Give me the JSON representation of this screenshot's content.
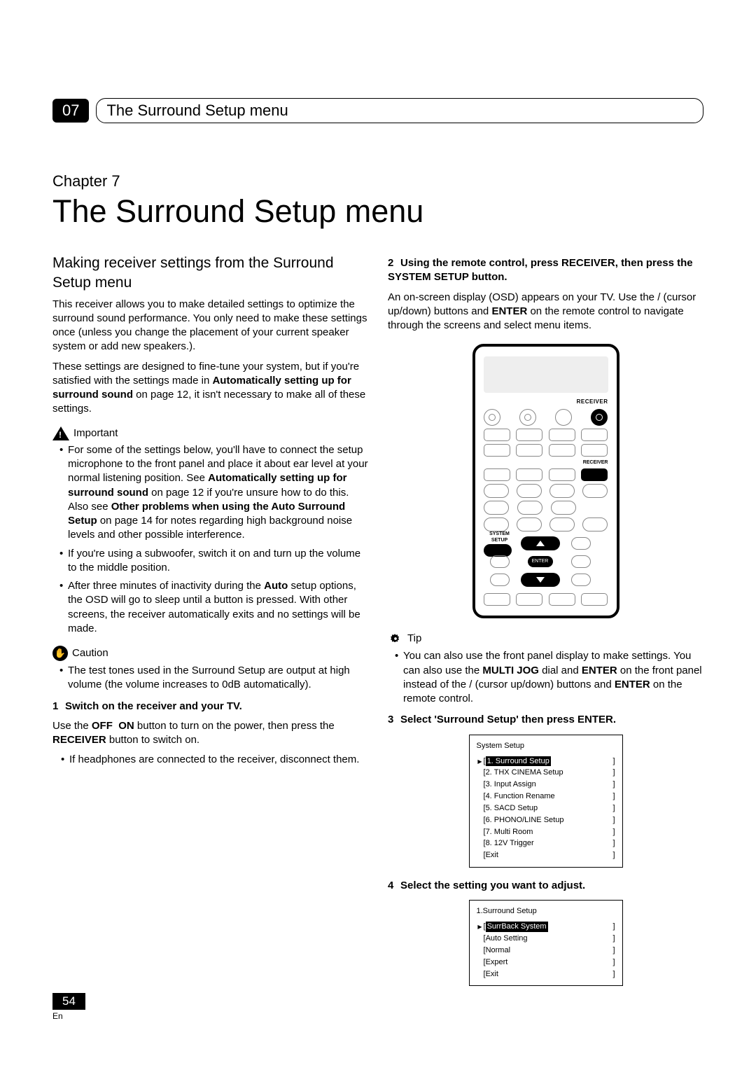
{
  "header": {
    "section_number": "07",
    "section_title": "The Surround Setup menu"
  },
  "chapter": {
    "label": "Chapter 7",
    "title": "The Surround Setup menu"
  },
  "left": {
    "subheading": "Making receiver settings from the Surround Setup menu",
    "intro1": "This receiver allows you to make detailed settings to optimize the surround sound performance. You only need to make these settings once (unless you change the placement of your current speaker system or add new speakers.).",
    "intro2_a": "These settings are designed to fine-tune your system, but if you're satisfied with the settings made in ",
    "intro2_b": "Automatically setting up for surround sound",
    "intro2_c": " on page 12, it isn't necessary to make all of these settings.",
    "important_label": "Important",
    "imp_b1_a": "For some of the settings below, you'll have to connect the setup microphone to the front panel and place it about ear level at your normal listening position. See ",
    "imp_b1_b": "Automatically setting up for surround sound",
    "imp_b1_c": " on page 12 if you're unsure how to do this. Also see ",
    "imp_b1_d": "Other problems when using the Auto Surround Setup",
    "imp_b1_e": " on page 14 for notes regarding high background noise levels and other possible interference.",
    "imp_b2": "If you're using a subwoofer, switch it on and turn up the volume to the middle position.",
    "imp_b3_a": "After three minutes of inactivity during the ",
    "imp_b3_b": "Auto",
    "imp_b3_c": " setup options, the OSD will go to sleep until a button is pressed. With other screens, the receiver automatically exits and no settings will be made.",
    "caution_label": "Caution",
    "caution_b1": "The test tones used in the Surround Setup are output at high volume (the volume increases to 0dB automatically).",
    "step1_num": "1",
    "step1_title": "Switch on the receiver and your TV.",
    "step1_body_a": "Use the  ",
    "step1_body_off": "OFF",
    "step1_body_on": "ON",
    "step1_body_b": " button to turn on the power, then press the   ",
    "step1_body_recv": "RECEIVER",
    "step1_body_c": " button to switch on.",
    "step1_sub": "If headphones are connected to the receiver, disconnect them."
  },
  "right": {
    "step2_num": "2",
    "step2_title": "Using the remote control, press RECEIVER, then press the SYSTEM SETUP button.",
    "step2_body_a": "An on-screen display (OSD) appears on your TV. Use the   /   (cursor up/down) buttons and ",
    "step2_body_enter": "ENTER",
    "step2_body_b": " on the remote control to navigate through the screens and select menu items.",
    "remote": {
      "label_receiver": "RECEIVER",
      "label_sys": "SYSTEM SETUP",
      "label_enter": "ENTER",
      "label_recv_btn": "RECEIVER"
    },
    "tip_label": "Tip",
    "tip_a": "You can also use the front panel display to make settings. You can also use the ",
    "tip_b": "MULTI JOG",
    "tip_c": " dial and ",
    "tip_d": "ENTER",
    "tip_e": " on the front panel instead of the   /   (cursor up/down) buttons and ",
    "tip_f": "ENTER",
    "tip_g": " on the remote control.",
    "step3_num": "3",
    "step3_title": "Select 'Surround Setup' then press ENTER.",
    "osd1": {
      "title": "System Setup",
      "items": [
        "1. Surround Setup",
        "2. THX CINEMA Setup",
        "3. Input Assign",
        "4. Function Rename",
        "5. SACD Setup",
        "6. PHONO/LINE Setup",
        "7. Multi Room",
        "8. 12V Trigger",
        "Exit"
      ]
    },
    "step4_num": "4",
    "step4_title": "Select the setting you want to adjust.",
    "osd2": {
      "title": "1.Surround Setup",
      "items": [
        "SurrBack System",
        "Auto Setting",
        "Normal",
        "Expert",
        "Exit"
      ]
    }
  },
  "footer": {
    "page_number": "54",
    "lang": "En"
  }
}
